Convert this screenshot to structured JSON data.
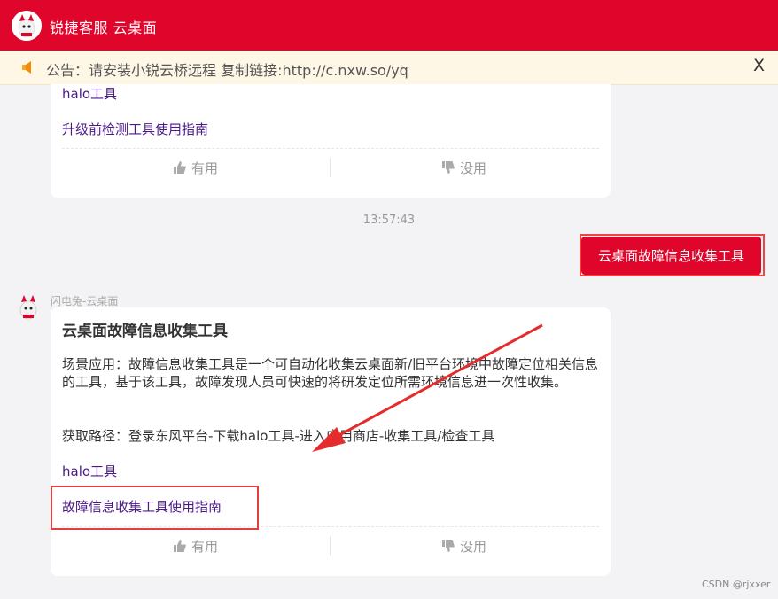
{
  "header": {
    "title": "锐捷客服 云桌面"
  },
  "notice": {
    "text": "公告：请安装小锐云桥远程 复制链接:http://c.nxw.so/yq",
    "close_label": "X"
  },
  "card1": {
    "links": [
      "halo工具",
      "升级前检测工具使用指南"
    ],
    "useful_label": "有用",
    "useless_label": "没用"
  },
  "timestamp": "13:57:43",
  "user_message": "云桌面故障信息收集工具",
  "bot": {
    "name": "闪电兔-云桌面"
  },
  "card2": {
    "title": "云桌面故障信息收集工具",
    "body": "场景应用：故障信息收集工具是一个可自动化收集云桌面新/旧平台环境中故障定位相关信息的工具，基于该工具，故障发现人员可快速的将研发定位所需环境信息进一次性收集。",
    "path": "获取路径：登录东风平台-下载halo工具-进入应用商店-收集工具/检查工具",
    "links": [
      "halo工具",
      "故障信息收集工具使用指南"
    ],
    "useful_label": "有用",
    "useless_label": "没用"
  },
  "colors": {
    "brand": "#e0062b",
    "link": "#4a1a86",
    "annotation": "#e04040"
  },
  "watermark": "CSDN @rjxxer"
}
